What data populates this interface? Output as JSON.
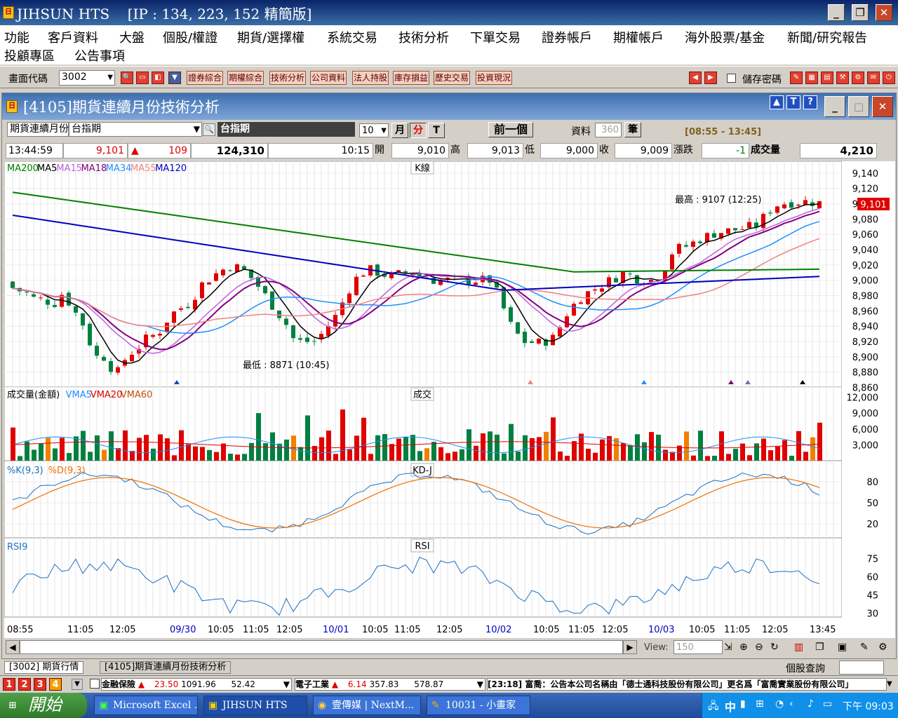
{
  "app": {
    "title": "JIHSUN HTS",
    "ip": "[IP : 134, 223, 152 精簡版]"
  },
  "menu": {
    "row1": [
      "功能",
      "客戶資料",
      "大盤",
      "個股/權證",
      "期貨/選擇權",
      "系統交易",
      "技術分析",
      "下單交易",
      "證券帳戶",
      "期權帳戶",
      "海外股票/基金",
      "新聞/研究報告"
    ],
    "row2": [
      "投顧專區",
      "公告事項"
    ]
  },
  "toolbar": {
    "code_label": "畫面代碼",
    "code_value": "3002",
    "buttons": [
      "證券綜合",
      "期權綜合",
      "技術分析",
      "公司資料",
      "法人持股",
      "庫存損益",
      "歷史交易",
      "投資現況"
    ],
    "save_pwd": "儲存密碼"
  },
  "window": {
    "title": "[4105]期貨連續月份技術分析"
  },
  "controls": {
    "category": "期貨連續月份",
    "symbol": "台指期",
    "symbol_display": "台指期",
    "period": "10",
    "unit_month": "月",
    "unit_min": "分",
    "unit_tick": "T",
    "prev": "前一個",
    "data_label": "資料",
    "data_count": "360",
    "data_unit": "筆",
    "session": "[08:55 - 13:45]"
  },
  "quote": {
    "time": "13:44:59",
    "price": "9,101",
    "change": "109",
    "volume_total": "124,310",
    "open_time": "10:15",
    "open_label": "開",
    "open": "9,010",
    "high_label": "高",
    "high": "9,013",
    "low_label": "低",
    "low": "9,000",
    "close_label": "收",
    "close": "9,009",
    "chg_label": "漲跌",
    "chg": "-1",
    "vol_label": "成交量",
    "vol": "4,210"
  },
  "chart": {
    "k_label": "K線",
    "vol_label": "成交",
    "kd_label": "KD-J",
    "rsi_label": "RSI",
    "ma_legend": [
      {
        "t": "MA200",
        "c": "#008000"
      },
      {
        "t": "MA5",
        "c": "#000000"
      },
      {
        "t": "MA15",
        "c": "#c060e0"
      },
      {
        "t": "MA18",
        "c": "#800080"
      },
      {
        "t": "MA34",
        "c": "#1e90ff"
      },
      {
        "t": "MA55",
        "c": "#f08080"
      },
      {
        "t": "MA120",
        "c": "#0000c0"
      }
    ],
    "vol_legend": [
      {
        "t": "成交量(金額)",
        "c": "#000000"
      },
      {
        "t": "VMA5",
        "c": "#1e90ff"
      },
      {
        "t": "VMA20",
        "c": "#e00000"
      },
      {
        "t": "VMA60",
        "c": "#c05000"
      }
    ],
    "kd_legend": [
      {
        "t": "%K(9,3)",
        "c": "#1e70c0"
      },
      {
        "t": "%D(9,3)",
        "c": "#f07000"
      }
    ],
    "rsi_legend": [
      {
        "t": "RSI9",
        "c": "#1e70c0"
      }
    ],
    "high_note": "最高 : 9107 (12:25)",
    "low_note": "最低 : 8871 (10:45)",
    "last_price": "9,101",
    "price_ticks": [
      "9,140",
      "9,120",
      "9,100",
      "9,080",
      "9,060",
      "9,040",
      "9,020",
      "9,000",
      "8,980",
      "8,960",
      "8,940",
      "8,920",
      "8,900",
      "8,880",
      "8,860"
    ],
    "vol_ticks": [
      "12,000",
      "9,000",
      "6,000",
      "3,000"
    ],
    "kd_ticks": [
      "80",
      "50",
      "20"
    ],
    "rsi_ticks": [
      "75",
      "60",
      "45",
      "30"
    ],
    "x_ticks": [
      {
        "t": "08:55",
        "b": false
      },
      {
        "t": "11:05",
        "b": false
      },
      {
        "t": "12:05",
        "b": false
      },
      {
        "t": "09/30",
        "b": true
      },
      {
        "t": "10:05",
        "b": false
      },
      {
        "t": "11:05",
        "b": false
      },
      {
        "t": "12:05",
        "b": false
      },
      {
        "t": "10/01",
        "b": true
      },
      {
        "t": "10:05",
        "b": false
      },
      {
        "t": "11:05",
        "b": false
      },
      {
        "t": "12:05",
        "b": false
      },
      {
        "t": "10/02",
        "b": true
      },
      {
        "t": "10:05",
        "b": false
      },
      {
        "t": "11:05",
        "b": false
      },
      {
        "t": "12:05",
        "b": false
      },
      {
        "t": "10/03",
        "b": true
      },
      {
        "t": "10:05",
        "b": false
      },
      {
        "t": "11:05",
        "b": false
      },
      {
        "t": "12:05",
        "b": false
      },
      {
        "t": "13:45",
        "b": false
      }
    ]
  },
  "chart_data": {
    "type": "candlestick",
    "title": "",
    "price_range": [
      8855,
      9150
    ],
    "high": {
      "value": 9107,
      "time": "12:25"
    },
    "low": {
      "value": 8871,
      "time": "10:45"
    },
    "last": 9101,
    "indicators": [
      "MA200",
      "MA5",
      "MA15",
      "MA18",
      "MA34",
      "MA55",
      "MA120",
      "VMA5",
      "VMA20",
      "VMA60",
      "%K(9,3)",
      "%D(9,3)",
      "RSI9"
    ],
    "vol_range": [
      0,
      13000
    ],
    "kd_range": [
      0,
      100
    ],
    "rsi_range": [
      20,
      85
    ]
  },
  "view": {
    "label": "View:",
    "value": "150"
  },
  "tabs": [
    "[3002] 期貨行情",
    "[4105]期貨連續月份技術分析"
  ],
  "stock_query": "個股查詢",
  "ticker": {
    "nums": [
      "1",
      "2",
      "3",
      "4"
    ],
    "item1_name": "金融保險",
    "item1_chg": "23.50",
    "item1_v1": "1091.96",
    "item1_v2": "52.42",
    "item2_name": "電子工業",
    "item2_chg": "6.14",
    "item2_v1": "357.83",
    "item2_v2": "578.87",
    "news": "[23:18] 富喬：公告本公司名稱由「德士通科技股份有限公司」更名爲「富喬實業股份有限公司」"
  },
  "taskbar": {
    "start": "開始",
    "items": [
      "Microsoft Excel ...",
      "JIHSUN HTS",
      "壹傳媒 | NextM...",
      "10031 - 小畫家"
    ],
    "ime": "中",
    "time": "下午 09:03"
  }
}
